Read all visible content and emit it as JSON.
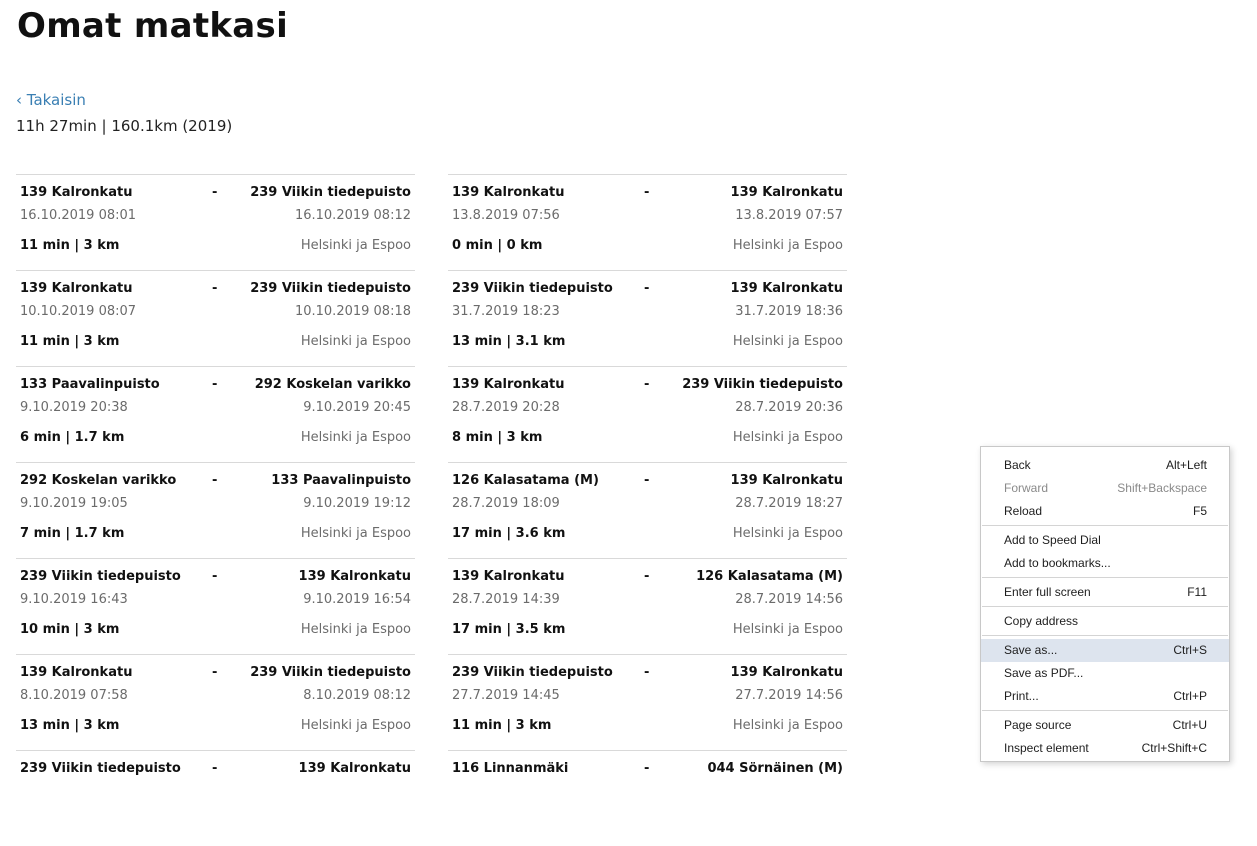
{
  "page": {
    "title": "Omat matkasi",
    "back_label": "‹ Takaisin",
    "summary": "11h 27min | 160.1km (2019)"
  },
  "trips_left": [
    {
      "from": "139 Kalronkatu",
      "dash": "-",
      "to": "239 Viikin tiedepuisto",
      "start": "16.10.2019 08:01",
      "end": "16.10.2019 08:12",
      "stats": "11 min  |  3 km",
      "region": "Helsinki ja Espoo"
    },
    {
      "from": "139 Kalronkatu",
      "dash": "-",
      "to": "239 Viikin tiedepuisto",
      "start": "10.10.2019 08:07",
      "end": "10.10.2019 08:18",
      "stats": "11 min  |  3 km",
      "region": "Helsinki ja Espoo"
    },
    {
      "from": "133 Paavalinpuisto",
      "dash": "-",
      "to": "292 Koskelan varikko",
      "start": "9.10.2019 20:38",
      "end": "9.10.2019 20:45",
      "stats": "6 min  |  1.7 km",
      "region": "Helsinki ja Espoo"
    },
    {
      "from": "292 Koskelan varikko",
      "dash": "-",
      "to": "133 Paavalinpuisto",
      "start": "9.10.2019 19:05",
      "end": "9.10.2019 19:12",
      "stats": "7 min  |  1.7 km",
      "region": "Helsinki ja Espoo"
    },
    {
      "from": "239 Viikin tiedepuisto",
      "dash": "-",
      "to": "139 Kalronkatu",
      "start": "9.10.2019 16:43",
      "end": "9.10.2019 16:54",
      "stats": "10 min  |  3 km",
      "region": "Helsinki ja Espoo"
    },
    {
      "from": "139 Kalronkatu",
      "dash": "-",
      "to": "239 Viikin tiedepuisto",
      "start": "8.10.2019 07:58",
      "end": "8.10.2019 08:12",
      "stats": "13 min  |  3 km",
      "region": "Helsinki ja Espoo"
    },
    {
      "from": "239 Viikin tiedepuisto",
      "dash": "-",
      "to": "139 Kalronkatu",
      "start": "",
      "end": "",
      "stats": "",
      "region": ""
    }
  ],
  "trips_right": [
    {
      "from": "139 Kalronkatu",
      "dash": "-",
      "to": "139 Kalronkatu",
      "start": "13.8.2019 07:56",
      "end": "13.8.2019 07:57",
      "stats": "0 min  |  0 km",
      "region": "Helsinki ja Espoo"
    },
    {
      "from": "239 Viikin tiedepuisto",
      "dash": "-",
      "to": "139 Kalronkatu",
      "start": "31.7.2019 18:23",
      "end": "31.7.2019 18:36",
      "stats": "13 min  |  3.1 km",
      "region": "Helsinki ja Espoo"
    },
    {
      "from": "139 Kalronkatu",
      "dash": "-",
      "to": "239 Viikin tiedepuisto",
      "start": "28.7.2019 20:28",
      "end": "28.7.2019 20:36",
      "stats": "8 min  |  3 km",
      "region": "Helsinki ja Espoo"
    },
    {
      "from": "126 Kalasatama (M)",
      "dash": "-",
      "to": "139 Kalronkatu",
      "start": "28.7.2019 18:09",
      "end": "28.7.2019 18:27",
      "stats": "17 min  |  3.6 km",
      "region": "Helsinki ja Espoo"
    },
    {
      "from": "139 Kalronkatu",
      "dash": "-",
      "to": "126 Kalasatama (M)",
      "start": "28.7.2019 14:39",
      "end": "28.7.2019 14:56",
      "stats": "17 min  |  3.5 km",
      "region": "Helsinki ja Espoo"
    },
    {
      "from": "239 Viikin tiedepuisto",
      "dash": "-",
      "to": "139 Kalronkatu",
      "start": "27.7.2019 14:45",
      "end": "27.7.2019 14:56",
      "stats": "11 min  |  3 km",
      "region": "Helsinki ja Espoo"
    },
    {
      "from": "116 Linnanmäki",
      "dash": "-",
      "to": "044 Sörnäinen (M)",
      "start": "",
      "end": "",
      "stats": "",
      "region": ""
    }
  ],
  "context_menu": {
    "groups": [
      [
        {
          "label": "Back",
          "shortcut": "Alt+Left",
          "disabled": false,
          "highlighted": false,
          "name": "ctx-back"
        },
        {
          "label": "Forward",
          "shortcut": "Shift+Backspace",
          "disabled": true,
          "highlighted": false,
          "name": "ctx-forward"
        },
        {
          "label": "Reload",
          "shortcut": "F5",
          "disabled": false,
          "highlighted": false,
          "name": "ctx-reload"
        }
      ],
      [
        {
          "label": "Add to Speed Dial",
          "shortcut": "",
          "disabled": false,
          "highlighted": false,
          "name": "ctx-add-speed-dial"
        },
        {
          "label": "Add to bookmarks...",
          "shortcut": "",
          "disabled": false,
          "highlighted": false,
          "name": "ctx-add-bookmarks"
        }
      ],
      [
        {
          "label": "Enter full screen",
          "shortcut": "F11",
          "disabled": false,
          "highlighted": false,
          "name": "ctx-full-screen"
        }
      ],
      [
        {
          "label": "Copy address",
          "shortcut": "",
          "disabled": false,
          "highlighted": false,
          "name": "ctx-copy-address"
        }
      ],
      [
        {
          "label": "Save as...",
          "shortcut": "Ctrl+S",
          "disabled": false,
          "highlighted": true,
          "name": "ctx-save-as"
        },
        {
          "label": "Save as PDF...",
          "shortcut": "",
          "disabled": false,
          "highlighted": false,
          "name": "ctx-save-pdf"
        },
        {
          "label": "Print...",
          "shortcut": "Ctrl+P",
          "disabled": false,
          "highlighted": false,
          "name": "ctx-print"
        }
      ],
      [
        {
          "label": "Page source",
          "shortcut": "Ctrl+U",
          "disabled": false,
          "highlighted": false,
          "name": "ctx-page-source"
        },
        {
          "label": "Inspect element",
          "shortcut": "Ctrl+Shift+C",
          "disabled": false,
          "highlighted": false,
          "name": "ctx-inspect"
        }
      ]
    ]
  }
}
